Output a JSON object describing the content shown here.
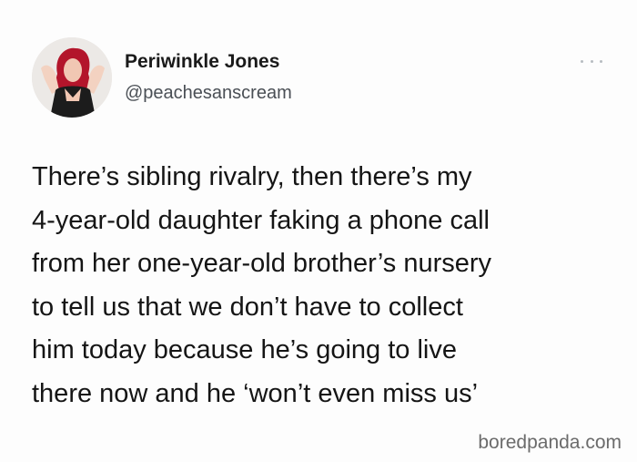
{
  "author": {
    "display_name": "Periwinkle Jones",
    "handle": "@peachesanscream",
    "avatar_icon": "profile-photo"
  },
  "more_icon": "ellipsis-icon",
  "tweet": {
    "lines": [
      "There’s sibling rivalry, then there’s my",
      "4-year-old daughter faking a phone call",
      "from her one-year-old brother’s nursery",
      "to tell us that we don’t have to collect",
      "him today because he’s going to live",
      "there now and he ‘won’t even miss us’"
    ]
  },
  "watermark": "boredpanda.com",
  "colors": {
    "background": "#fdfdfd",
    "name": "#1a1a1a",
    "handle": "#4a4f55",
    "text": "#151515",
    "watermark": "#6b6b6b"
  }
}
